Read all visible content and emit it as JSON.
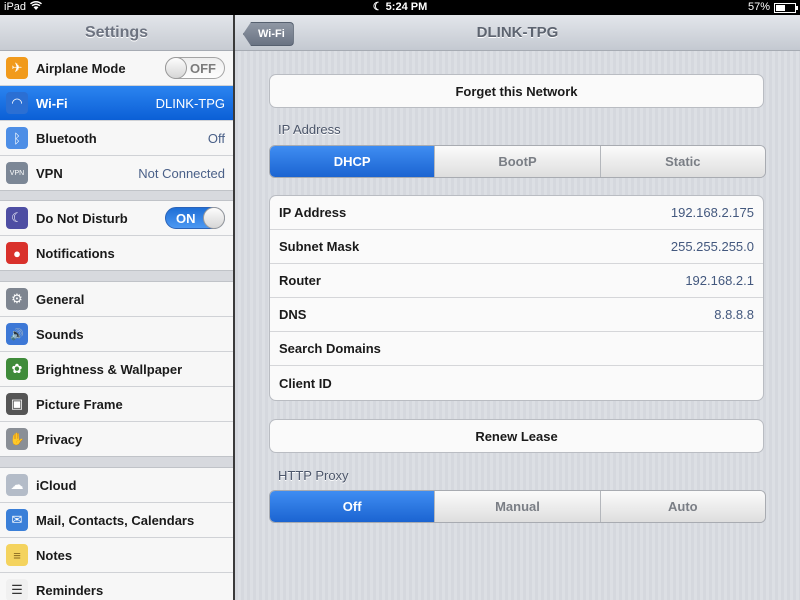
{
  "status_bar": {
    "device": "iPad",
    "time": "5:24 PM",
    "battery": "57%",
    "battery_level": 0.57
  },
  "sidebar": {
    "title": "Settings",
    "groups": [
      [
        {
          "label": "Airplane Mode",
          "icon": "airplane-icon",
          "toggle": "OFF"
        },
        {
          "label": "Wi-Fi",
          "icon": "wifi-icon",
          "value": "DLINK-TPG",
          "selected": true
        },
        {
          "label": "Bluetooth",
          "icon": "bluetooth-icon",
          "value": "Off"
        },
        {
          "label": "VPN",
          "icon": "vpn-icon",
          "value": "Not Connected"
        }
      ],
      [
        {
          "label": "Do Not Disturb",
          "icon": "moon-icon",
          "toggle": "ON"
        },
        {
          "label": "Notifications",
          "icon": "notifications-icon"
        }
      ],
      [
        {
          "label": "General",
          "icon": "gear-icon"
        },
        {
          "label": "Sounds",
          "icon": "speaker-icon"
        },
        {
          "label": "Brightness & Wallpaper",
          "icon": "flower-icon"
        },
        {
          "label": "Picture Frame",
          "icon": "picture-frame-icon"
        },
        {
          "label": "Privacy",
          "icon": "hand-icon"
        }
      ],
      [
        {
          "label": "iCloud",
          "icon": "cloud-icon"
        },
        {
          "label": "Mail, Contacts, Calendars",
          "icon": "mail-icon"
        },
        {
          "label": "Notes",
          "icon": "notes-icon"
        },
        {
          "label": "Reminders",
          "icon": "reminders-icon"
        }
      ]
    ]
  },
  "detail": {
    "back_label": "Wi-Fi",
    "title": "DLINK-TPG",
    "forget_label": "Forget this Network",
    "ip_section_label": "IP Address",
    "ip_modes": [
      "DHCP",
      "BootP",
      "Static"
    ],
    "ip_mode_selected": "DHCP",
    "info_rows": [
      {
        "key": "IP Address",
        "value": "192.168.2.175"
      },
      {
        "key": "Subnet Mask",
        "value": "255.255.255.0"
      },
      {
        "key": "Router",
        "value": "192.168.2.1"
      },
      {
        "key": "DNS",
        "value": "8.8.8.8"
      },
      {
        "key": "Search Domains",
        "value": ""
      },
      {
        "key": "Client ID",
        "value": ""
      }
    ],
    "renew_label": "Renew Lease",
    "proxy_section_label": "HTTP Proxy",
    "proxy_modes": [
      "Off",
      "Manual",
      "Auto"
    ],
    "proxy_mode_selected": "Off"
  }
}
